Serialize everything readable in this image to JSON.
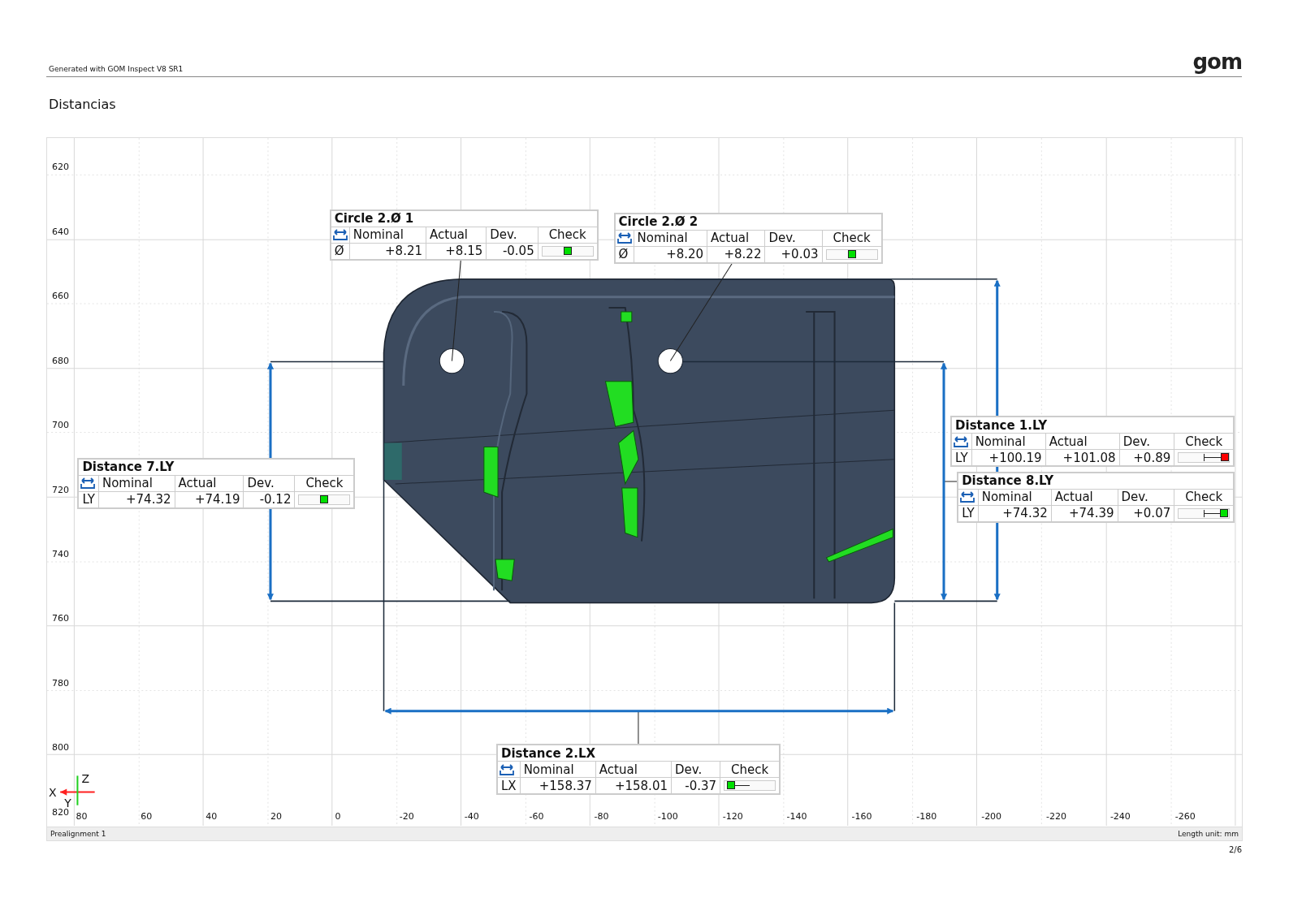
{
  "header": {
    "generator": "Generated with GOM Inspect V8 SR1",
    "logo": "gom"
  },
  "page_title": "Distancias",
  "viewport": {
    "y_ticks": [
      "620",
      "640",
      "660",
      "680",
      "700",
      "720",
      "740",
      "760",
      "780",
      "800",
      "820"
    ],
    "x_ticks": [
      "80",
      "60",
      "40",
      "20",
      "0",
      "-20",
      "-40",
      "-60",
      "-80",
      "-100",
      "-120",
      "-140",
      "-160",
      "-180",
      "-200",
      "-220",
      "-240",
      "-260"
    ],
    "axes": {
      "x": "X",
      "y": "Y",
      "z": "Z"
    },
    "labels": [
      {
        "title": "Circle 2.Ø 1",
        "columns": [
          "Nominal",
          "Actual",
          "Dev.",
          "Check"
        ],
        "axis": "Ø",
        "nominal": "+8.21",
        "actual": "+8.15",
        "dev": "-0.05",
        "check": {
          "color": "#00e000",
          "level": 0.5
        }
      },
      {
        "title": "Circle 2.Ø 2",
        "columns": [
          "Nominal",
          "Actual",
          "Dev.",
          "Check"
        ],
        "axis": "Ø",
        "nominal": "+8.20",
        "actual": "+8.22",
        "dev": "+0.03",
        "check": {
          "color": "#00e000",
          "level": 0.5
        }
      },
      {
        "title": "Distance 1.LY",
        "columns": [
          "Nominal",
          "Actual",
          "Dev.",
          "Check"
        ],
        "axis": "LY",
        "nominal": "+100.19",
        "actual": "+101.08",
        "dev": "+0.89",
        "check": {
          "color": "#ff0000",
          "level": 0.92
        }
      },
      {
        "title": "Distance 8.LY",
        "columns": [
          "Nominal",
          "Actual",
          "Dev.",
          "Check"
        ],
        "axis": "LY",
        "nominal": "+74.32",
        "actual": "+74.39",
        "dev": "+0.07",
        "check": {
          "color": "#00e000",
          "level": 0.9
        }
      },
      {
        "title": "Distance 7.LY",
        "columns": [
          "Nominal",
          "Actual",
          "Dev.",
          "Check"
        ],
        "axis": "LY",
        "nominal": "+74.32",
        "actual": "+74.19",
        "dev": "-0.12",
        "check": {
          "color": "#00e000",
          "level": 0.5
        }
      },
      {
        "title": "Distance 2.LX",
        "columns": [
          "Nominal",
          "Actual",
          "Dev.",
          "Check"
        ],
        "axis": "LX",
        "nominal": "+158.37",
        "actual": "+158.01",
        "dev": "-0.37",
        "check": {
          "color": "#00e000",
          "level": 0.12
        }
      }
    ],
    "status": {
      "left": "Prealignment 1",
      "right": "Length unit: mm"
    }
  },
  "page_number": "2/6"
}
